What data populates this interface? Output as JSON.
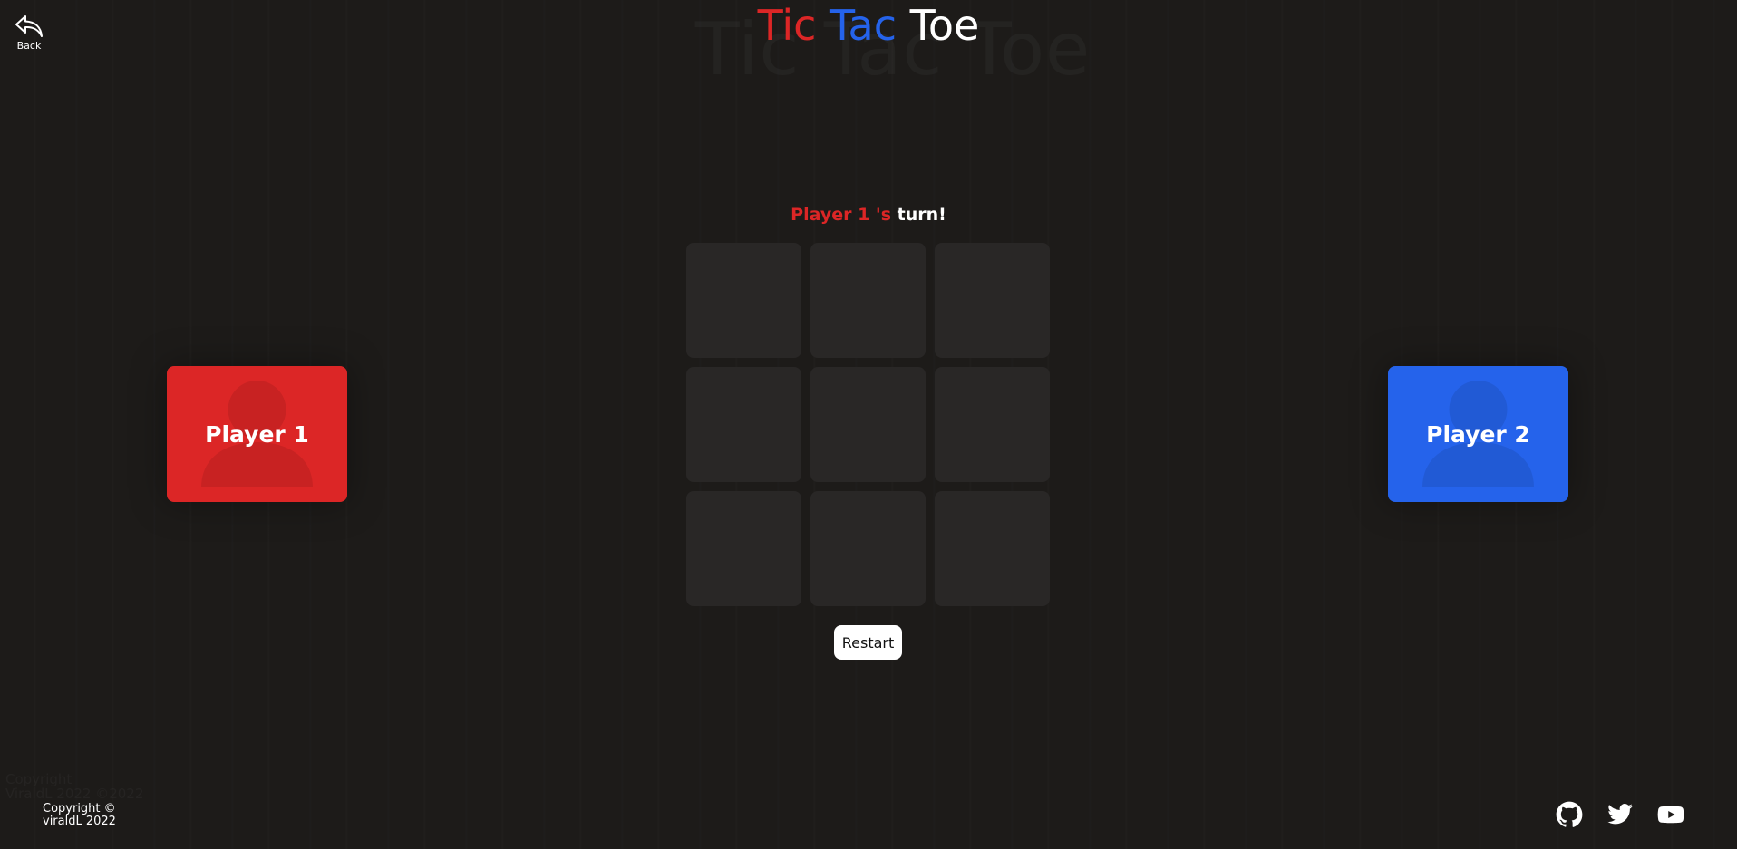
{
  "nav": {
    "back_label": "Back",
    "back_icon": "reply-arrow-icon"
  },
  "title": {
    "tic": "Tic",
    "tac": "Tac",
    "toe": "Toe",
    "shadow_text": "Tic Tac Toe"
  },
  "status": {
    "player_name": "Player 1 's",
    "suffix": "turn!"
  },
  "board": {
    "cells": [
      "",
      "",
      "",
      "",
      "",
      "",
      "",
      "",
      ""
    ]
  },
  "controls": {
    "restart_label": "Restart"
  },
  "players": {
    "p1": {
      "label": "Player 1",
      "color": "#dc2626",
      "icon": "user-silhouette-icon"
    },
    "p2": {
      "label": "Player 2",
      "color": "#2563eb",
      "icon": "user-silhouette-icon"
    }
  },
  "footer": {
    "copyright_line1": "Copyright ©",
    "copyright_line2": "viraldL 2022",
    "shadow_line1": "Copyright",
    "shadow_line2": "ViraldL 2022 ©2022",
    "socials": [
      {
        "name": "github",
        "icon": "github-icon"
      },
      {
        "name": "twitter",
        "icon": "twitter-icon"
      },
      {
        "name": "youtube",
        "icon": "youtube-icon"
      }
    ]
  },
  "colors": {
    "background": "#1d1b19",
    "cell": "#292726",
    "player1": "#dc2626",
    "player2": "#2563eb"
  }
}
